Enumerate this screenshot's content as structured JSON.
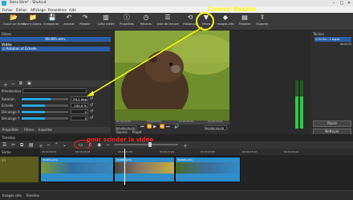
{
  "window": {
    "title": "Sans titre* - Shotcut",
    "minimize": "–",
    "maximize": "□",
    "close": "✕"
  },
  "menu": [
    "Fichier",
    "Édition",
    "Affichage",
    "Paramètres",
    "Aide"
  ],
  "toolbar": [
    {
      "label": "Ouvrir un fichier",
      "icon": "open-file-icon"
    },
    {
      "label": "Ouvrir Autres",
      "icon": "open-other-icon"
    },
    {
      "label": "Enregistrer",
      "icon": "save-icon"
    },
    {
      "label": "Annuler",
      "icon": "undo-icon"
    },
    {
      "label": "Rétablir",
      "icon": "redo-icon"
    },
    {
      "label": "Crête mètre",
      "icon": "peak-meter-icon"
    },
    {
      "label": "Propriétés",
      "icon": "properties-icon"
    },
    {
      "label": "Récents",
      "icon": "recent-icon"
    },
    {
      "label": "Liste de lecture",
      "icon": "playlist-icon"
    },
    {
      "label": "Historique",
      "icon": "history-icon"
    },
    {
      "label": "Filtres",
      "icon": "filters-icon"
    },
    {
      "label": "Images-clés",
      "icon": "keyframes-icon"
    },
    {
      "label": "Timeline",
      "icon": "timeline-icon"
    },
    {
      "label": "Exporter",
      "icon": "export-icon"
    }
  ],
  "filters_panel": {
    "title": "Filtres",
    "clip_name": "Wildlife.wmv",
    "section_video": "Vidéo",
    "filter_item": "Rotation et Échelle",
    "preset_label": "Présélection",
    "params": [
      {
        "label": "Rotation",
        "value": "90,1 deg",
        "fill": 0.62
      },
      {
        "label": "Échelle",
        "value": "100,0 %",
        "fill": 0.5
      },
      {
        "label": "Décalage X",
        "value": "0",
        "fill": 0.5
      },
      {
        "label": "Décalage Y",
        "value": "0",
        "fill": 0.5
      }
    ],
    "bottom_tabs": [
      "Propriétés",
      "Filtres",
      "Exporter"
    ]
  },
  "player": {
    "time_current": "00:00:05:00",
    "time_total": "00:00:10:00",
    "ruler": [
      "00:00:00:00",
      "00:00:03:20",
      "00:00:06:40",
      "00:00:10:00"
    ],
    "tabs": [
      "Source",
      "Projet"
    ]
  },
  "annotations": {
    "choose_rotate": "Choisir Rotate",
    "split_video": "pour scinder la vidéo"
  },
  "right_panel": {
    "title": "Tâches",
    "job": "En file - 1 signal",
    "job_status": "00:00:01",
    "pause_button": "Pause",
    "clean_button": "Nettoyer",
    "meter_scale": [
      "0",
      "-5",
      "-10",
      "-15",
      "-20",
      "-25",
      "-30",
      "-35",
      "-40",
      "-45",
      "-50"
    ]
  },
  "timeline": {
    "title": "Timeline",
    "track_output": "Sortie",
    "track_v1": "V1",
    "ruler": [
      "00:00:00:00",
      "00:00:05:00",
      "00:00:10:00",
      "00:00:15:00",
      "00:00:20:00",
      "00:00:25:00",
      "00:00:30:00"
    ],
    "clip_names": [
      "Wildlife.wmv",
      "Wildlife.wmv",
      "Wildlife.wmv"
    ]
  },
  "status": {
    "tabs": [
      "Images clés",
      "Timeline"
    ]
  }
}
